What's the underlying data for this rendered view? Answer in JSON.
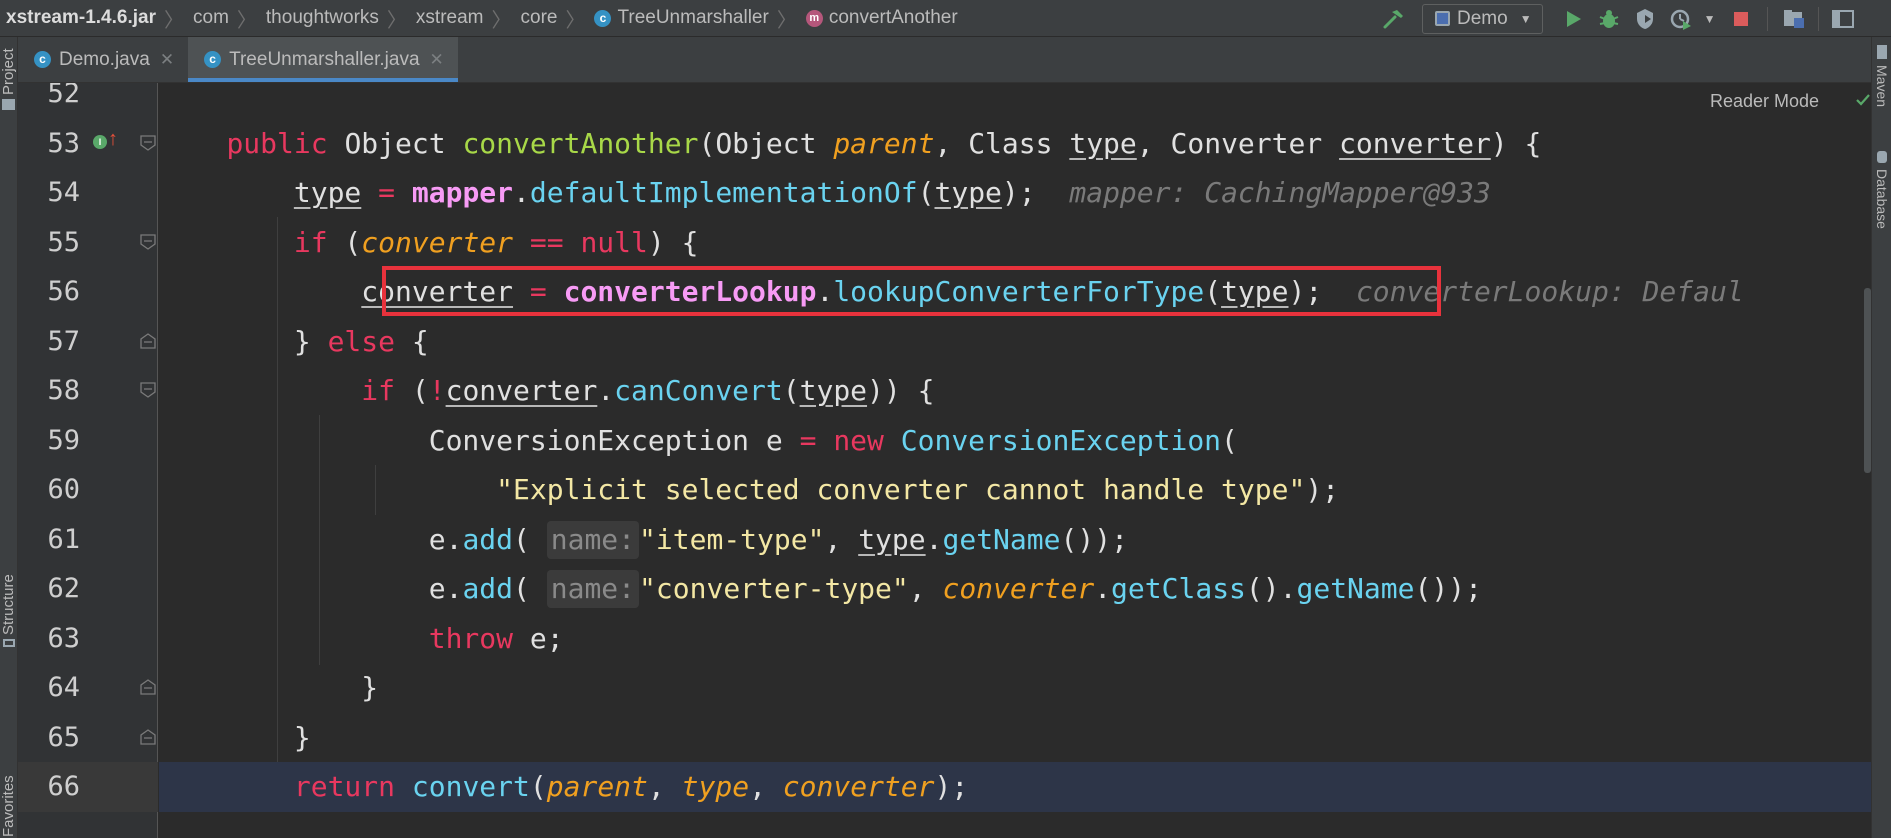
{
  "breadcrumbs": [
    {
      "label": "xstream-1.4.6.jar",
      "icon": null,
      "bold": true
    },
    {
      "label": "com",
      "icon": null,
      "bold": false
    },
    {
      "label": "thoughtworks",
      "icon": null,
      "bold": false
    },
    {
      "label": "xstream",
      "icon": null,
      "bold": false
    },
    {
      "label": "core",
      "icon": null,
      "bold": false
    },
    {
      "label": "TreeUnmarshaller",
      "icon": "class-icon",
      "bold": false
    },
    {
      "label": "convertAnother",
      "icon": "method-icon",
      "bold": false
    }
  ],
  "toolbar": {
    "run_config": "Demo",
    "icons": [
      "build-hammer-icon",
      "run-icon",
      "debug-icon",
      "coverage-icon",
      "profile-icon",
      "stop-icon",
      "project-structure-icon",
      "sdk-icon"
    ]
  },
  "left_strip": {
    "project_label": "Project",
    "structure_label": "Structure",
    "favorites_label": "Favorites"
  },
  "right_strip": {
    "maven_label": "Maven",
    "database_label": "Database"
  },
  "tabs": [
    {
      "label": "Demo.java",
      "active": false
    },
    {
      "label": "TreeUnmarshaller.java",
      "active": true
    }
  ],
  "editor": {
    "reader_mode": "Reader Mode",
    "line_numbers": [
      "52",
      "53",
      "54",
      "55",
      "56",
      "57",
      "58",
      "59",
      "60",
      "61",
      "62",
      "63",
      "64",
      "65",
      "66"
    ],
    "highlighted_line": "56",
    "current_line": "66",
    "hints": {
      "line54": "mapper: CachingMapper@933",
      "line56": "converterLookup: Defaul",
      "name_param": "name:"
    },
    "strings": {
      "explicit": "\"Explicit selected converter cannot handle type\"",
      "item_type": "\"item-type\"",
      "converter_type": "\"converter-type\""
    }
  },
  "colors": {
    "keyword": "#e8385f",
    "method": "#6ad3f0",
    "declaration": "#a8d848",
    "parameter": "#f0a020",
    "field": "#f79bf5",
    "string": "#f3e7a4",
    "highlight_box": "#e8323c"
  }
}
